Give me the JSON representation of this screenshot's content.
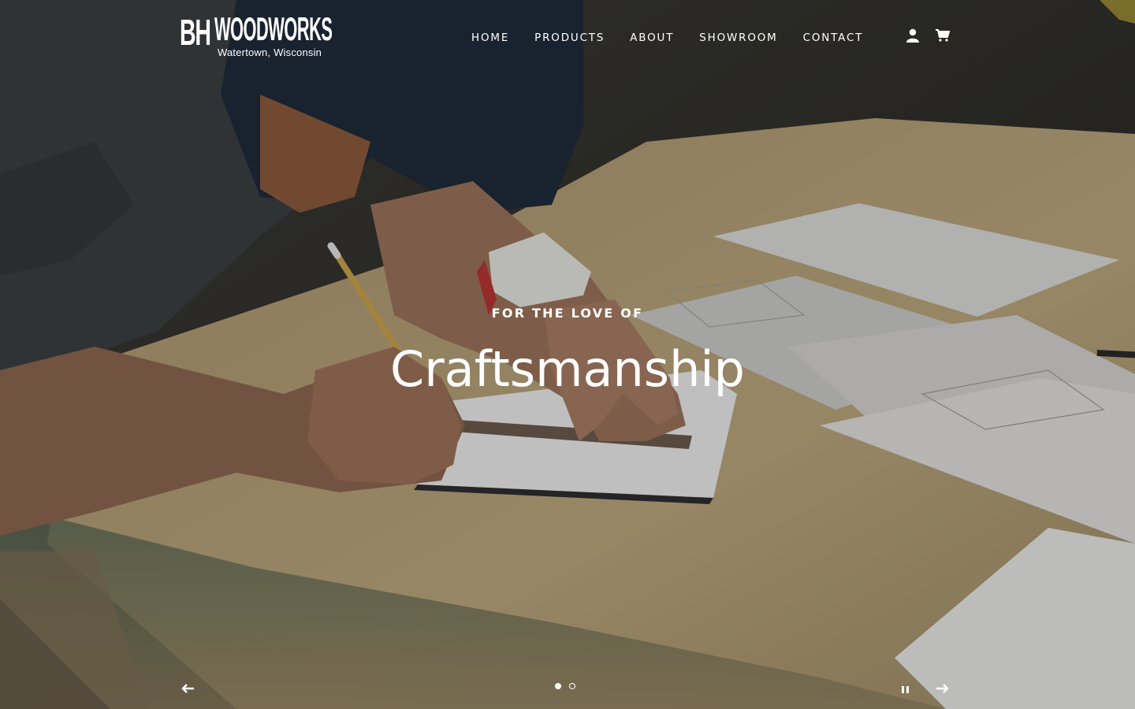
{
  "brand": {
    "mark": "BH",
    "name": "WOODWORKS",
    "location": "Watertown, Wisconsin"
  },
  "nav": {
    "items": [
      "HOME",
      "PRODUCTS",
      "ABOUT",
      "SHOWROOM",
      "CONTACT"
    ]
  },
  "header_icons": {
    "account": "user-icon",
    "cart": "cart-icon"
  },
  "slideshow": {
    "kicker": "FOR THE LOVE OF",
    "headline": "Craftsmanship",
    "slide_count": 2,
    "active_slide": 1,
    "controls": {
      "prev": "arrow-left-icon",
      "pause": "pause-icon",
      "next": "arrow-right-icon"
    }
  },
  "colors": {
    "text": "#ffffff",
    "tabletop": "#c8b48a",
    "shirt": "#3a3f42",
    "background": "#2a2a28"
  }
}
